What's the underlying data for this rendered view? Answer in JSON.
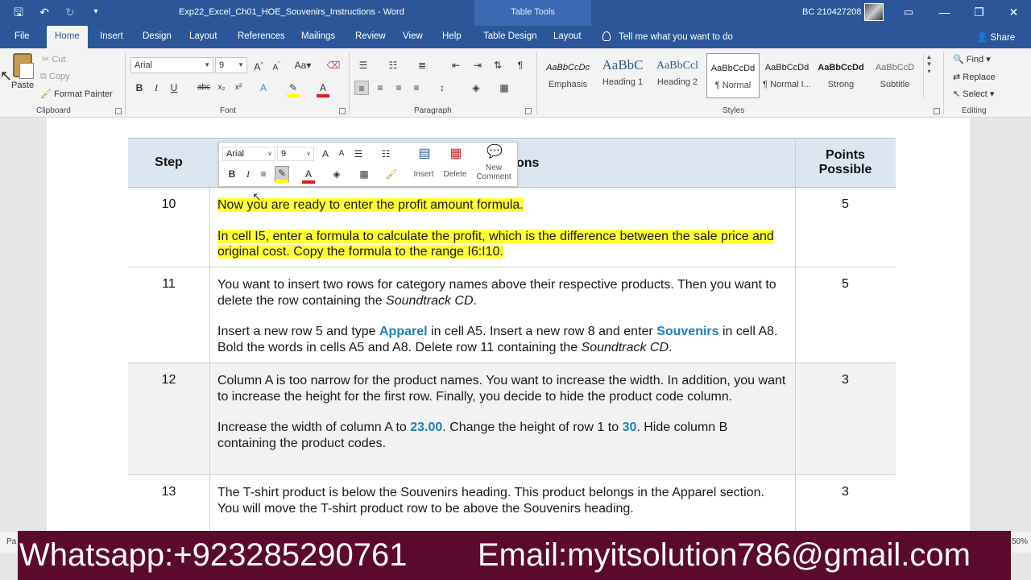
{
  "window": {
    "doc_title": "Exp22_Excel_Ch01_HOE_Souvenirs_Instructions  -  Word",
    "contextual_tab": "Table Tools",
    "account": "BC 210427208"
  },
  "tabs": [
    "File",
    "Home",
    "Insert",
    "Design",
    "Layout",
    "References",
    "Mailings",
    "Review",
    "View",
    "Help",
    "Table Design",
    "Layout"
  ],
  "tell_me": "Tell me what you want to do",
  "share": "Share",
  "clipboard": {
    "paste": "Paste",
    "cut": "Cut",
    "copy": "Copy",
    "format_painter": "Format Painter",
    "label": "Clipboard"
  },
  "font": {
    "name": "Arial",
    "size": "9",
    "label": "Font"
  },
  "paragraph": {
    "label": "Paragraph"
  },
  "styles": {
    "label": "Styles",
    "items": [
      {
        "sample": "AaBbCcDc",
        "name": "Emphasis"
      },
      {
        "sample": "AaBbC",
        "name": "Heading 1"
      },
      {
        "sample": "AaBbCcl",
        "name": "Heading 2"
      },
      {
        "sample": "AaBbCcDd",
        "name": "¶ Normal"
      },
      {
        "sample": "AaBbCcDd",
        "name": "¶ Normal I..."
      },
      {
        "sample": "AaBbCcDd",
        "name": "Strong"
      },
      {
        "sample": "AaBbCcD",
        "name": "Subtitle"
      }
    ]
  },
  "editing": {
    "find": "Find",
    "replace": "Replace",
    "select": "Select",
    "label": "Editing"
  },
  "mini_toolbar": {
    "font": "Arial",
    "size": "9",
    "insert": "Insert",
    "delete": "Delete",
    "new_comment_1": "New",
    "new_comment_2": "Comment"
  },
  "table": {
    "headers": {
      "step": "Step",
      "instructions_partial": "ons",
      "points_1": "Points",
      "points_2": "Possible"
    },
    "rows": [
      {
        "step": "10",
        "points": "5",
        "p1": "Now you are ready to enter the profit amount formula.",
        "p2": "In cell I5, enter a formula to calculate the profit, which is the difference between the sale price and original cost. Copy the formula to the range I6:I10."
      },
      {
        "step": "11",
        "points": "5",
        "p1a": "You want to insert two rows for category names above their respective products. Then you want to delete the row containing the ",
        "p1b": "Soundtrack CD",
        "p1c": ".",
        "p2a": "Insert a new row 5 and type ",
        "p2b": "Apparel",
        "p2c": " in cell A5. Insert a new row 8 and enter ",
        "p2d": "Souvenirs",
        "p2e": " in cell A8. Bold the words in cells A5 and A8. Delete row 11 containing the ",
        "p2f": "Soundtrack CD",
        "p2g": "."
      },
      {
        "step": "12",
        "points": "3",
        "p1": "Column A is too narrow for the product names. You want to increase the width. In addition, you want to increase the height for the first row. Finally, you decide to hide the product code column.",
        "p2a": "Increase the width of column A to ",
        "p2b": "23.00",
        "p2c": ". Change the height of row 1 to ",
        "p2d": "30",
        "p2e": ". Hide column B containing the product codes."
      },
      {
        "step": "13",
        "points": "3",
        "p1": "The T-shirt product is below the Souvenirs heading. This product belongs in the Apparel section. You will move the T-shirt product row to be above the Souvenirs heading."
      }
    ]
  },
  "status": {
    "left": "Pa",
    "zoom": "50%"
  },
  "banner": {
    "whatsapp": "Whatsapp:+923285290761",
    "email": "Email:myitsolution786@gmail.com"
  },
  "colors": {
    "word_blue": "#2b579a",
    "highlight": "#ffff33",
    "keyword": "#1f7fb8",
    "banner_bg": "#5b0a2e"
  }
}
